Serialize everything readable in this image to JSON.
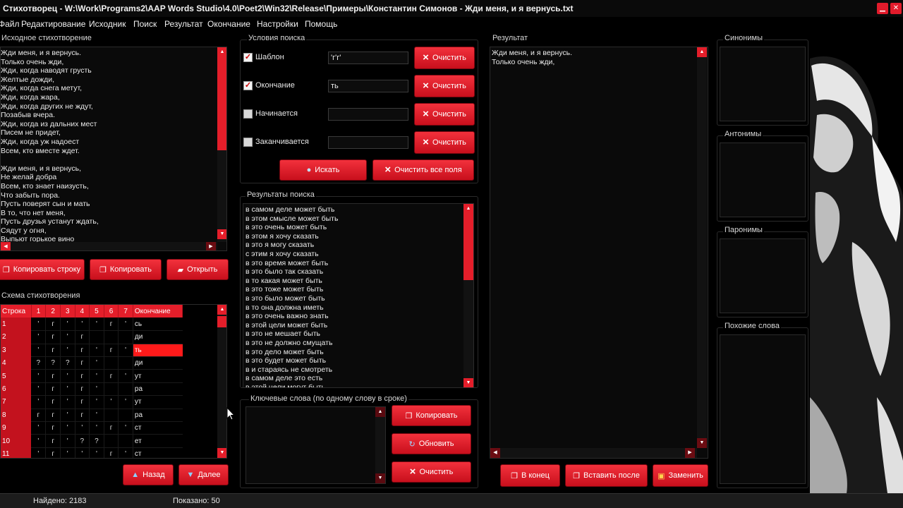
{
  "window": {
    "title": "Стихотворец - W:\\Work\\Programs2\\AAP Words Studio\\4.0\\Poet2\\Win32\\Release\\Примеры\\Константин Симонов - Жди меня, и я вернусь.txt"
  },
  "menu": [
    "Файл",
    "Редактирование",
    "Исходник",
    "Поиск",
    "Результат",
    "Окончание",
    "Настройки",
    "Помощь"
  ],
  "source": {
    "label": "Исходное стихотворение",
    "lines": [
      "Жди меня, и я вернусь.",
      "Только очень жди,",
      "Жди, когда наводят грусть",
      "Желтые дожди,",
      "Жди, когда снега метут,",
      "Жди, когда жара,",
      "Жди, когда других не ждут,",
      "Позабыв вчера.",
      "Жди, когда из дальних мест",
      "Писем не придет,",
      "Жди, когда уж надоест",
      "Всем, кто вместе ждет.",
      "",
      "Жди меня, и я вернусь,",
      "Не желай добра",
      "Всем, кто знает наизусть,",
      "Что забыть пора.",
      "Пусть поверят сын и мать",
      "В то, что нет меня,",
      "Пусть друзья устанут ждать,",
      "Сядут у огня,",
      "Выпьют горькое вино"
    ],
    "buttons": {
      "copy_line": "Копировать строку",
      "copy": "Копировать",
      "open": "Открыть"
    }
  },
  "conditions": {
    "label": "Условия поиска",
    "rows": [
      {
        "label": "Шаблон",
        "checked": true,
        "value": "'г'г'"
      },
      {
        "label": "Окончание",
        "checked": true,
        "value": "ть"
      },
      {
        "label": "Начинается",
        "checked": false,
        "value": ""
      },
      {
        "label": "Заканчивается",
        "checked": false,
        "value": ""
      }
    ],
    "clear_label": "Очистить",
    "search_label": "Искать",
    "clear_all_label": "Очистить все поля"
  },
  "search_results": {
    "label": "Результаты поиска",
    "items": [
      "в самом деле может быть",
      "в этом смысле может быть",
      "в это очень может быть",
      "в этом я хочу сказать",
      "в это я могу сказать",
      "с этим я хочу сказать",
      "в это время может быть",
      "в это было так сказать",
      "в то какая может быть",
      "в это тоже может быть",
      "в это было может быть",
      "в то она должна иметь",
      "в это очень важно знать",
      "в этой цели может быть",
      "в это не мешает быть",
      "в это не должно смущать",
      "в это дело может быть",
      "в это будет может быть",
      "в и стараясь не смотреть",
      "в самом деле это есть",
      "в этой цели могут быть"
    ]
  },
  "keywords": {
    "label": "Ключевые слова (по одному слову в сроке)",
    "copy_label": "Копировать",
    "refresh_label": "Обновить",
    "clear_label": "Очистить"
  },
  "result": {
    "label": "Результат",
    "lines": [
      "Жди меня, и я вернусь.",
      "Только очень жди,"
    ],
    "to_end_label": "В конец",
    "insert_after_label": "Вставить после",
    "replace_label": "Заменить"
  },
  "side_panels": {
    "synonyms": "Синонимы",
    "antonyms": "Антонимы",
    "paronyms": "Паронимы",
    "similar": "Похожие слова"
  },
  "scheme": {
    "label": "Схема стихотворения",
    "headers": [
      "Строка",
      "1",
      "2",
      "3",
      "4",
      "5",
      "6",
      "7",
      "Окончание"
    ],
    "selected_row": 3,
    "rows": [
      {
        "n": "1",
        "cells": [
          "'",
          "г",
          "'",
          "'",
          "'",
          "г",
          "'"
        ],
        "end": "сь"
      },
      {
        "n": "2",
        "cells": [
          "'",
          "г",
          "'",
          "г",
          "",
          "",
          ""
        ],
        "end": "ди"
      },
      {
        "n": "3",
        "cells": [
          "'",
          "г",
          "'",
          "г",
          "'",
          "г",
          "'"
        ],
        "end": "ть"
      },
      {
        "n": "4",
        "cells": [
          "?",
          "?",
          "?",
          "г",
          "'",
          "",
          ""
        ],
        "end": "ди"
      },
      {
        "n": "5",
        "cells": [
          "'",
          "г",
          "'",
          "г",
          "'",
          "г",
          "'"
        ],
        "end": "ут"
      },
      {
        "n": "6",
        "cells": [
          "'",
          "г",
          "'",
          "г",
          "'",
          "",
          ""
        ],
        "end": "ра"
      },
      {
        "n": "7",
        "cells": [
          "'",
          "г",
          "'",
          "г",
          "'",
          "'",
          "'"
        ],
        "end": "ут"
      },
      {
        "n": "8",
        "cells": [
          "г",
          "г",
          "'",
          "г",
          "'",
          "",
          ""
        ],
        "end": "ра"
      },
      {
        "n": "9",
        "cells": [
          "'",
          "г",
          "'",
          "'",
          "'",
          "г",
          "'"
        ],
        "end": "ст"
      },
      {
        "n": "10",
        "cells": [
          "'",
          "г",
          "'",
          "?",
          "?",
          "",
          ""
        ],
        "end": "ет"
      },
      {
        "n": "11",
        "cells": [
          "'",
          "г",
          "'",
          "'",
          "'",
          "г",
          "'"
        ],
        "end": "ст"
      }
    ],
    "back_label": "Назад",
    "next_label": "Далее"
  },
  "status": {
    "found": "Найдено: 2183",
    "shown": "Показано: 50"
  },
  "colors": {
    "accent": "#e41e2a",
    "background": "#000000",
    "panel": "#0a0a0a"
  }
}
